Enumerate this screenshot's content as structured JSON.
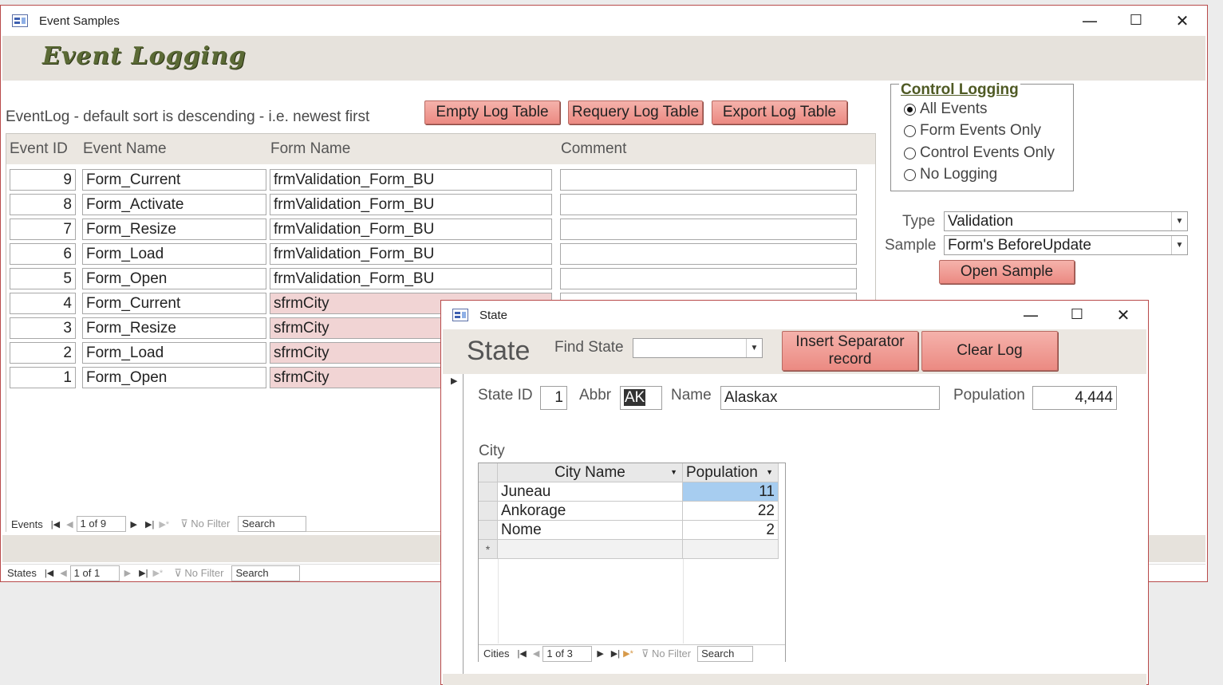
{
  "main_window": {
    "title": "Event Samples",
    "minimize": "—",
    "maximize": "☐",
    "close": "✕",
    "logo_text": "Event Logging",
    "caption": "EventLog - default sort is descending - i.e. newest first",
    "buttons": {
      "empty": "Empty Log Table",
      "requery": "Requery Log Table",
      "export": "Export Log Table"
    },
    "columns": [
      "Event ID",
      "Event Name",
      "Form Name",
      "Comment"
    ],
    "rows": [
      {
        "id": "9",
        "event": "Form_Current",
        "form": "frmValidation_Form_BU",
        "comment": ""
      },
      {
        "id": "8",
        "event": "Form_Activate",
        "form": "frmValidation_Form_BU",
        "comment": ""
      },
      {
        "id": "7",
        "event": "Form_Resize",
        "form": "frmValidation_Form_BU",
        "comment": ""
      },
      {
        "id": "6",
        "event": "Form_Load",
        "form": "frmValidation_Form_BU",
        "comment": ""
      },
      {
        "id": "5",
        "event": "Form_Open",
        "form": "frmValidation_Form_BU",
        "comment": ""
      },
      {
        "id": "4",
        "event": "Form_Current",
        "form": "sfrmCity",
        "comment": ""
      },
      {
        "id": "3",
        "event": "Form_Resize",
        "form": "sfrmCity",
        "comment": ""
      },
      {
        "id": "2",
        "event": "Form_Load",
        "form": "sfrmCity",
        "comment": ""
      },
      {
        "id": "1",
        "event": "Form_Open",
        "form": "sfrmCity",
        "comment": ""
      }
    ],
    "events_nav": {
      "label": "Events",
      "record": "1 of 9",
      "filter": "No Filter",
      "search": "Search"
    },
    "states_nav": {
      "label": "States",
      "record": "1 of 1",
      "filter": "No Filter",
      "search": "Search"
    },
    "control_logging": {
      "title": "Control Logging",
      "options": [
        "All Events",
        "Form Events Only",
        "Control Events Only",
        "No Logging"
      ],
      "selected": 0
    },
    "type_label": "Type",
    "type_value": "Validation",
    "sample_label": "Sample",
    "sample_value": "Form's BeforeUpdate",
    "open_sample": "Open Sample"
  },
  "state_window": {
    "title": "State",
    "minimize": "—",
    "maximize": "☐",
    "close": "✕",
    "heading": "State",
    "find_label": "Find State",
    "find_value": "",
    "insert_btn_line1": "Insert Separator",
    "insert_btn_line2": "record",
    "clear_btn": "Clear Log",
    "state_id_label": "State ID",
    "state_id": "1",
    "abbr_label": "Abbr",
    "abbr": "AK",
    "name_label": "Name",
    "name": "Alaskax",
    "population_label": "Population",
    "population": "4,444",
    "city_label": "City",
    "city_columns": [
      "City Name",
      "Population"
    ],
    "cities": [
      {
        "name": "Juneau",
        "pop": "11"
      },
      {
        "name": "Ankorage",
        "pop": "22"
      },
      {
        "name": "Nome",
        "pop": "2"
      }
    ],
    "new_row_marker": "*",
    "cities_nav": {
      "label": "Cities",
      "record": "1 of 3",
      "filter": "No Filter",
      "search": "Search"
    }
  },
  "colors": {
    "accent_button": "#eb8a82",
    "header_band": "#e6e2dc",
    "pink_cell": "#f1d4d4",
    "selected_cell": "#a7cdf0",
    "window_border": "#b84a4a"
  }
}
